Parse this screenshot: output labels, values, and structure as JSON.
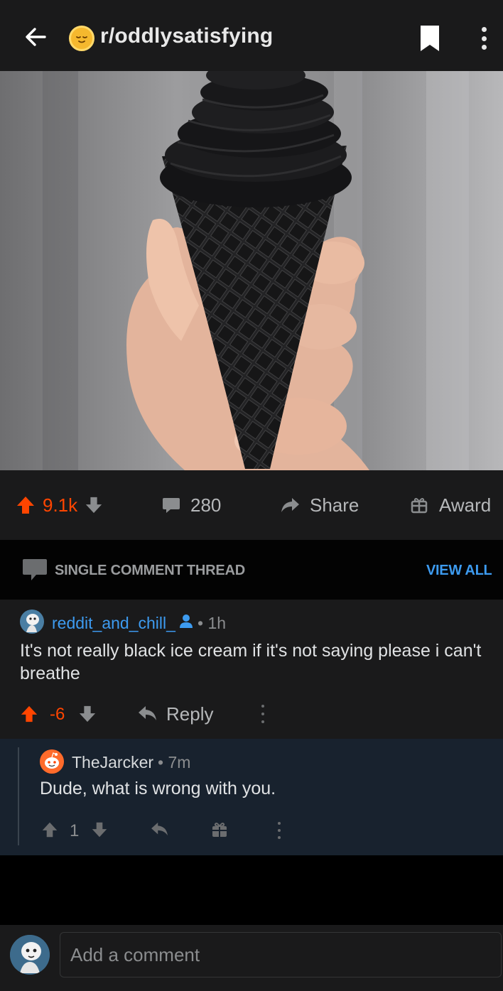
{
  "header": {
    "subreddit": "r/oddlysatisfying"
  },
  "post": {
    "image_alt": "black soft-serve ice cream in a black cone held in a hand",
    "score": "9.1k",
    "comments_count": "280",
    "share_label": "Share",
    "award_label": "Award"
  },
  "thread_banner": {
    "label": "SINGLE COMMENT THREAD",
    "view_all": "VIEW ALL"
  },
  "comments": [
    {
      "author": "reddit_and_chill_",
      "meta": "• 1h",
      "body": "It's not really black ice cream if it's not saying please i can't breathe",
      "score": "-6",
      "reply_label": "Reply"
    },
    {
      "author": "TheJarcker",
      "meta": "• 7m",
      "body": "Dude, what is wrong with you.",
      "score": "1"
    }
  ],
  "composer": {
    "placeholder": "Add a comment"
  },
  "colors": {
    "upvote": "#ff4500",
    "link_blue": "#3d9bf0",
    "background": "#1a1a1b"
  }
}
